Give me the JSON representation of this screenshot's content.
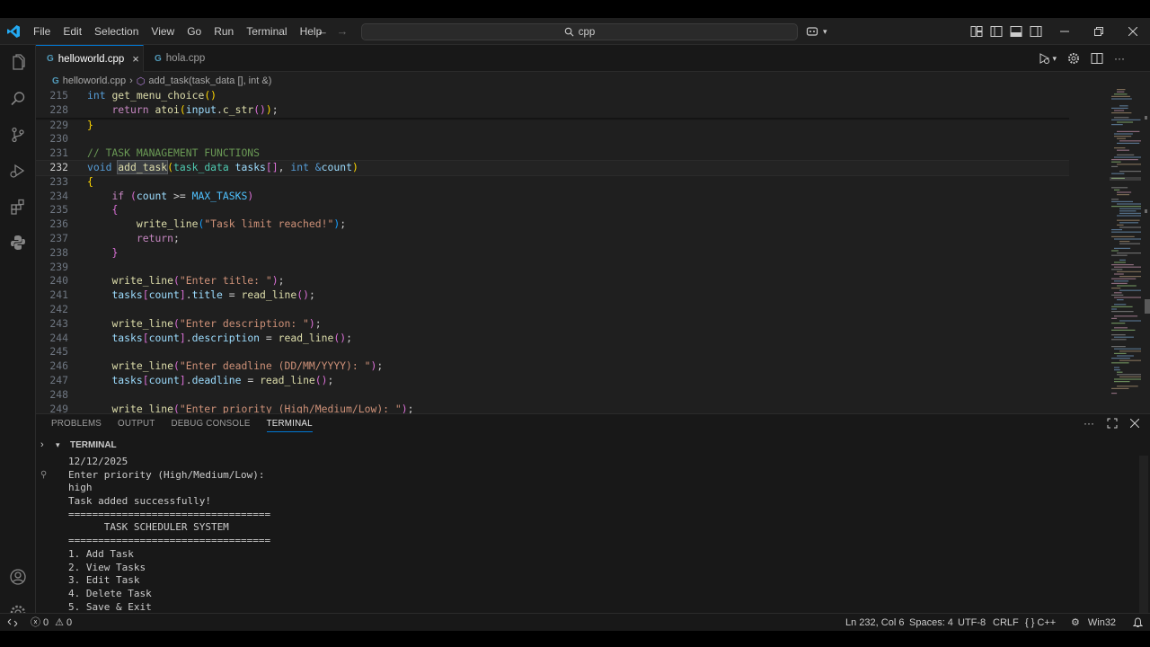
{
  "titlebar": {
    "menu": [
      "File",
      "Edit",
      "Selection",
      "View",
      "Go",
      "Run",
      "Terminal",
      "Help"
    ],
    "search_text": "cpp"
  },
  "tabs": [
    {
      "label": "helloworld.cpp",
      "active": true
    },
    {
      "label": "hola.cpp",
      "active": false
    }
  ],
  "breadcrumbs": {
    "file": "helloworld.cpp",
    "symbol": "add_task(task_data [], int &)"
  },
  "editor": {
    "sticky": [
      {
        "num": "215",
        "html": "<span class=\"kw\">int</span> <span class=\"fn\">get_menu_choice</span><span class=\"brk1\">()</span>"
      },
      {
        "num": "228",
        "html": "    <span class=\"ctrl\">return</span> <span class=\"fn\">atoi</span><span class=\"brk1\">(</span><span class=\"var\">input</span>.<span class=\"fn\">c_str</span><span class=\"brk2\">()</span><span class=\"brk1\">)</span>;"
      }
    ],
    "lines": [
      {
        "num": "229",
        "html": "<span class=\"brk1\">}</span>"
      },
      {
        "num": "230",
        "html": ""
      },
      {
        "num": "231",
        "html": "<span class=\"cmt\">// TASK MANAGEMENT FUNCTIONS</span>"
      },
      {
        "num": "232",
        "html": "<span class=\"kw\">void</span> <span class=\"fn sel-word\">add_task</span><span class=\"brk1\">(</span><span class=\"type\">task_data</span> <span class=\"var\">tasks</span><span class=\"brk2\">[]</span>, <span class=\"kw\">int</span> <span class=\"kw\">&amp;</span><span class=\"var\">count</span><span class=\"brk1\">)</span>",
        "current": true
      },
      {
        "num": "233",
        "html": "<span class=\"brk1\">{</span>"
      },
      {
        "num": "234",
        "html": "    <span class=\"ctrl\">if</span> <span class=\"brk2\">(</span><span class=\"var\">count</span> &gt;= <span class=\"mac\">MAX_TASKS</span><span class=\"brk2\">)</span>"
      },
      {
        "num": "235",
        "html": "    <span class=\"brk2\">{</span>"
      },
      {
        "num": "236",
        "html": "        <span class=\"fn\">write_line</span><span class=\"brk3\">(</span><span class=\"str\">\"Task limit reached!\"</span><span class=\"brk3\">)</span>;"
      },
      {
        "num": "237",
        "html": "        <span class=\"ctrl\">return</span>;"
      },
      {
        "num": "238",
        "html": "    <span class=\"brk2\">}</span>"
      },
      {
        "num": "239",
        "html": ""
      },
      {
        "num": "240",
        "html": "    <span class=\"fn\">write_line</span><span class=\"brk2\">(</span><span class=\"str\">\"Enter title: \"</span><span class=\"brk2\">)</span>;"
      },
      {
        "num": "241",
        "html": "    <span class=\"var\">tasks</span><span class=\"brk2\">[</span><span class=\"var\">count</span><span class=\"brk2\">]</span>.<span class=\"var\">title</span> = <span class=\"fn\">read_line</span><span class=\"brk2\">()</span>;"
      },
      {
        "num": "242",
        "html": ""
      },
      {
        "num": "243",
        "html": "    <span class=\"fn\">write_line</span><span class=\"brk2\">(</span><span class=\"str\">\"Enter description: \"</span><span class=\"brk2\">)</span>;"
      },
      {
        "num": "244",
        "html": "    <span class=\"var\">tasks</span><span class=\"brk2\">[</span><span class=\"var\">count</span><span class=\"brk2\">]</span>.<span class=\"var\">description</span> = <span class=\"fn\">read_line</span><span class=\"brk2\">()</span>;"
      },
      {
        "num": "245",
        "html": ""
      },
      {
        "num": "246",
        "html": "    <span class=\"fn\">write_line</span><span class=\"brk2\">(</span><span class=\"str\">\"Enter deadline (DD/MM/YYYY): \"</span><span class=\"brk2\">)</span>;"
      },
      {
        "num": "247",
        "html": "    <span class=\"var\">tasks</span><span class=\"brk2\">[</span><span class=\"var\">count</span><span class=\"brk2\">]</span>.<span class=\"var\">deadline</span> = <span class=\"fn\">read_line</span><span class=\"brk2\">()</span>;"
      },
      {
        "num": "248",
        "html": ""
      },
      {
        "num": "249",
        "html": "    <span class=\"fn\">write_line</span><span class=\"brk2\">(</span><span class=\"str\">\"Enter priority (High/Medium/Low): \"</span><span class=\"brk2\">)</span>;"
      }
    ]
  },
  "panel": {
    "tabs": [
      "PROBLEMS",
      "OUTPUT",
      "DEBUG CONSOLE",
      "TERMINAL"
    ],
    "active_tab": "TERMINAL",
    "section_title": "TERMINAL",
    "terminal_lines": [
      "12/12/2025",
      "Enter priority (High/Medium/Low):",
      "high",
      "Task added successfully!",
      "==================================",
      "      TASK SCHEDULER SYSTEM",
      "==================================",
      "1. Add Task",
      "2. View Tasks",
      "3. Edit Task",
      "4. Delete Task",
      "5. Save & Exit"
    ]
  },
  "statusbar": {
    "errors": "0",
    "warnings": "0",
    "cursor": "Ln 232, Col 6",
    "spaces": "Spaces: 4",
    "encoding": "UTF-8",
    "eol": "CRLF",
    "language": "C++",
    "platform": "Win32"
  },
  "colors": {
    "accent": "#0078d4",
    "background": "#1f1f1f"
  }
}
